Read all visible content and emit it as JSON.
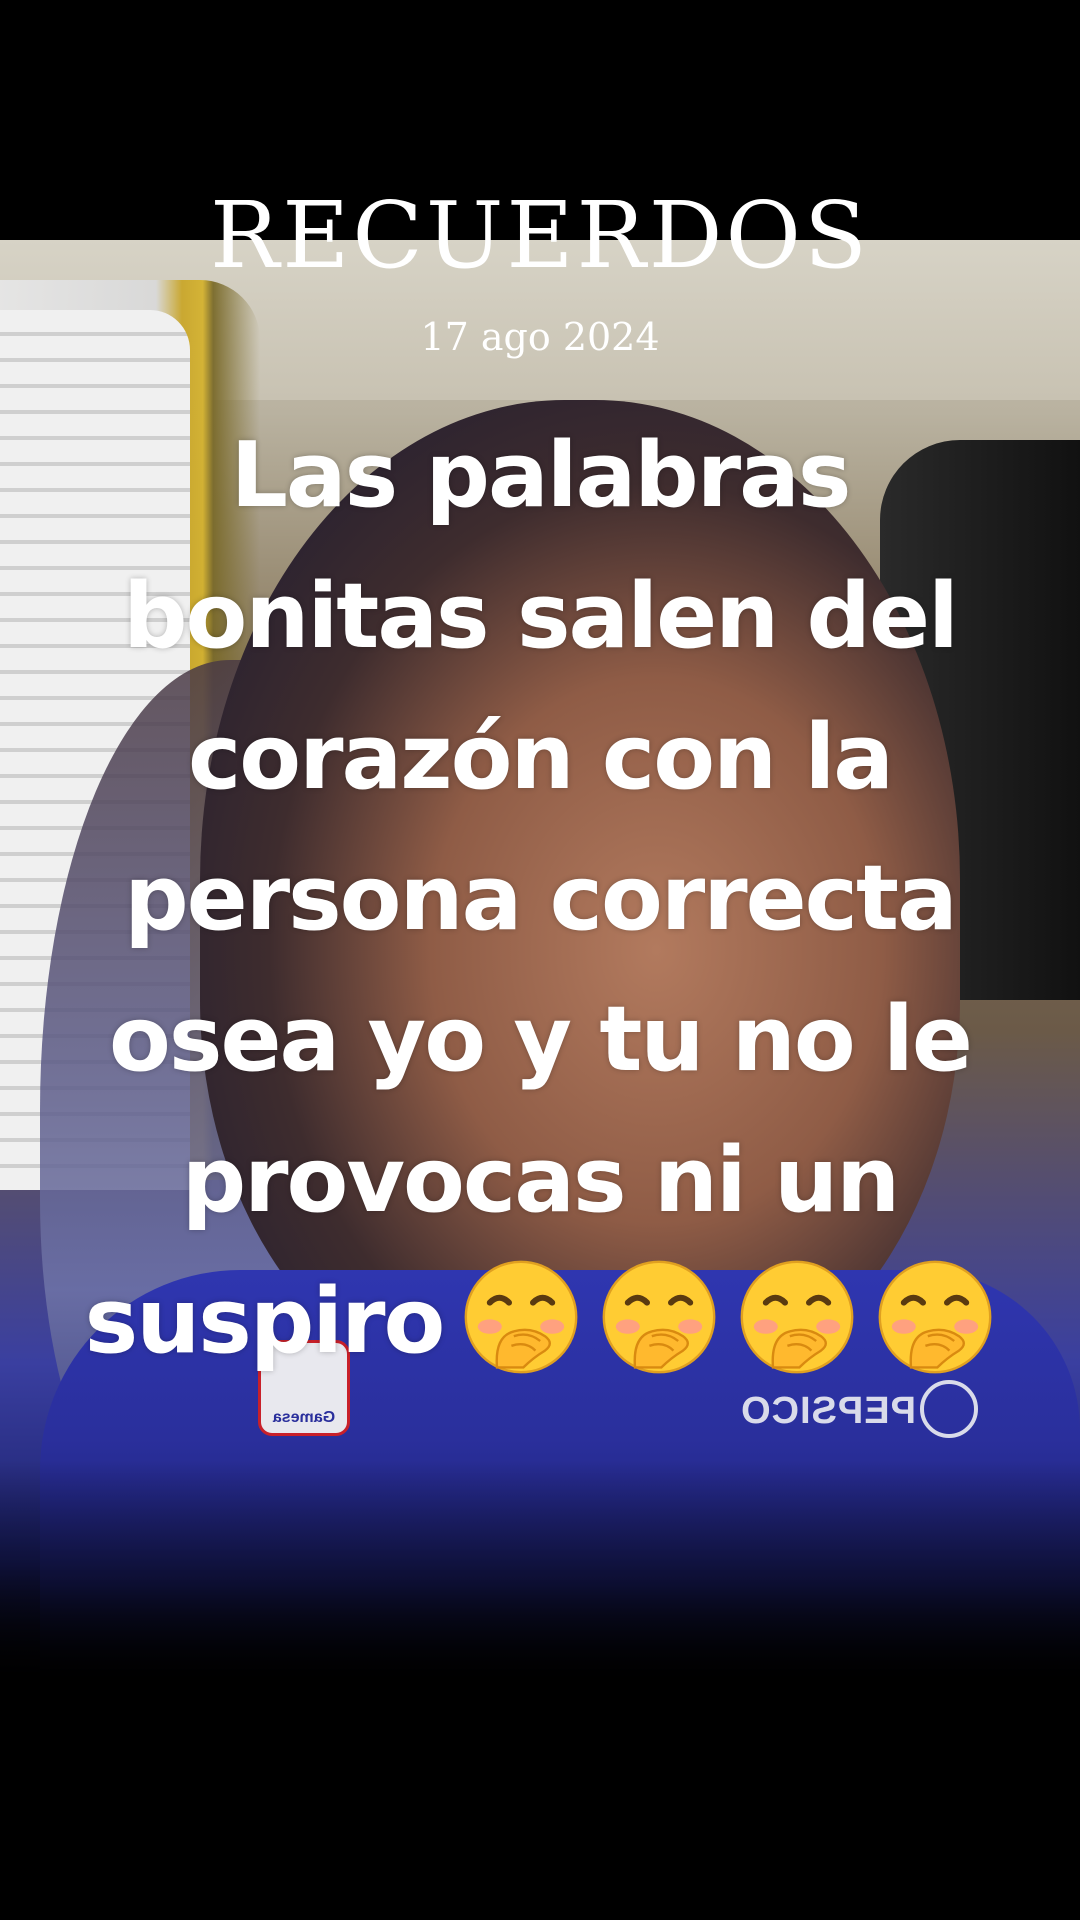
{
  "overlay": {
    "title": "RECUERDOS",
    "date": "17 ago 2024"
  },
  "caption": {
    "lines": [
      "Las palabras",
      "bonitas salen del",
      "corazón con  la",
      "persona correcta",
      "osea yo y tu no le",
      "provocas ni un",
      "suspiro"
    ],
    "emoji_name": "face-with-hand-over-mouth",
    "emoji_count": 4
  },
  "photo": {
    "logo_left_text": "Gamesa",
    "logo_right_text": "PEPSICO"
  },
  "colors": {
    "background": "#000000",
    "shirt": "#2f36b0",
    "text": "#ffffff",
    "emoji_face": "#ffcc33"
  }
}
